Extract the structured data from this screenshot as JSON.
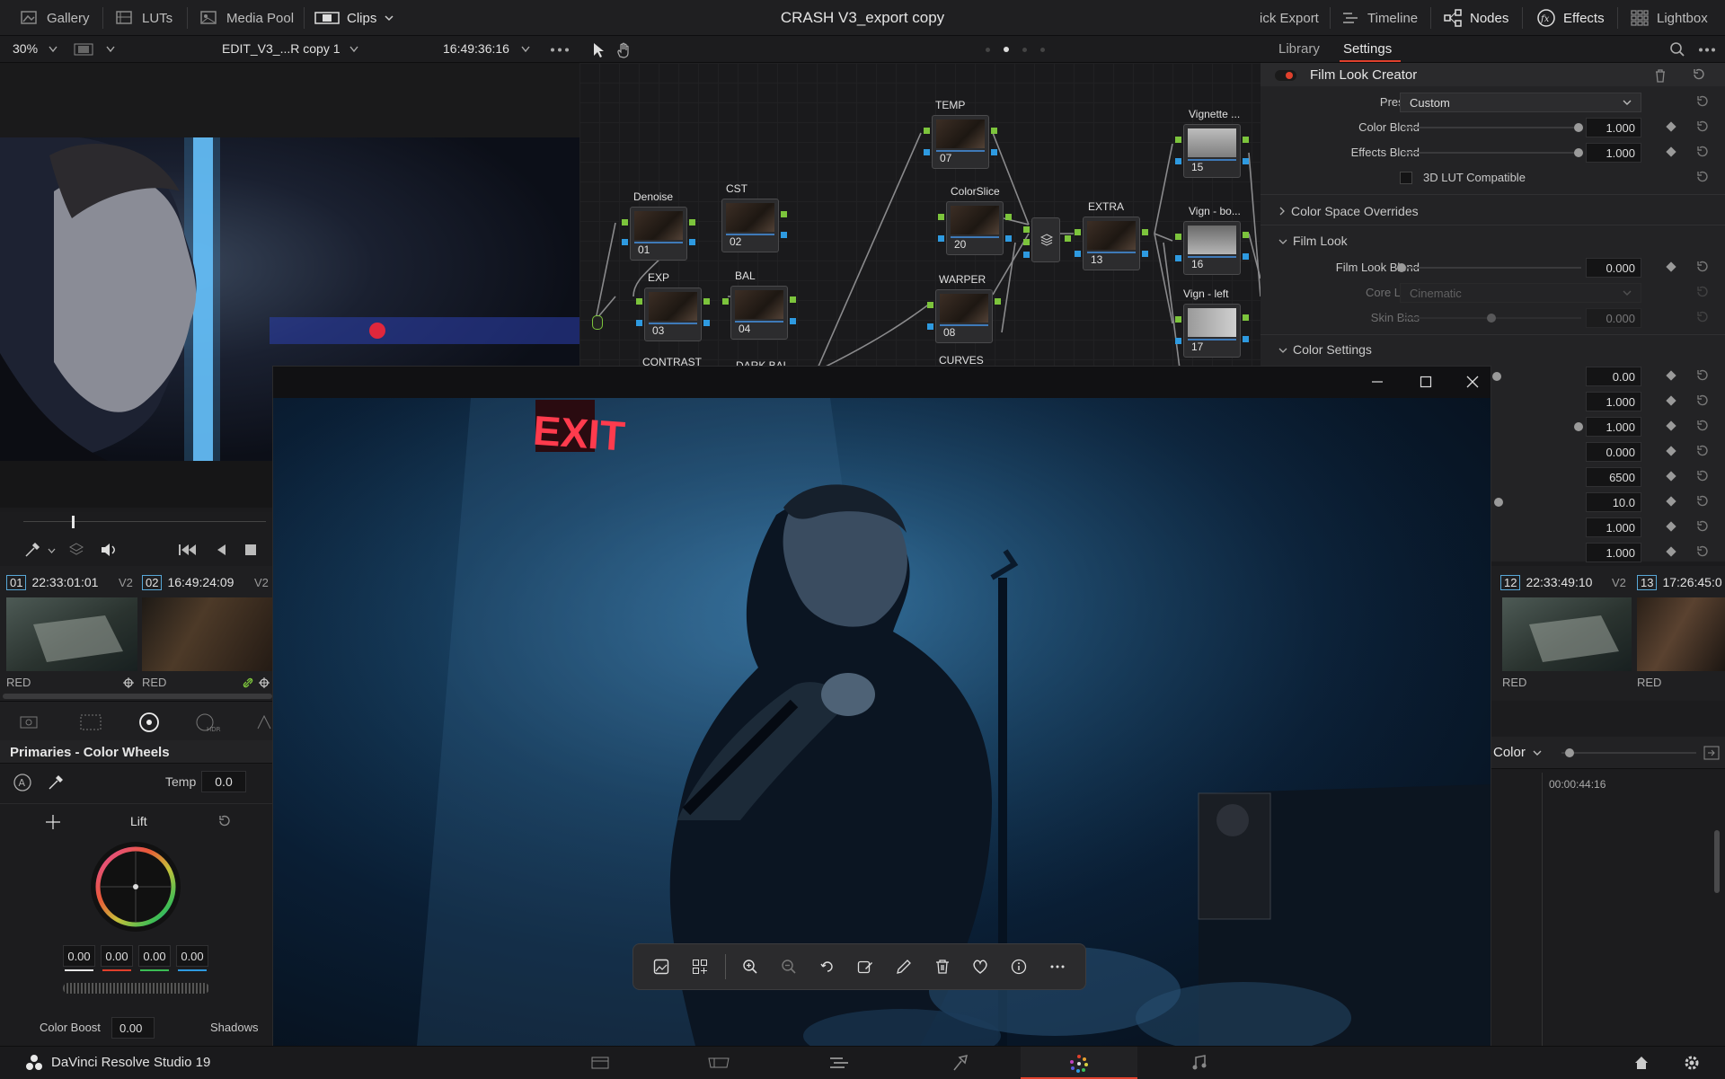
{
  "topbar": {
    "left_items": [
      {
        "label": "Gallery",
        "icon": "gallery-icon"
      },
      {
        "label": "LUTs",
        "icon": "luts-icon"
      },
      {
        "label": "Media Pool",
        "icon": "media-pool-icon"
      },
      {
        "label": "Clips",
        "icon": "clips-icon"
      }
    ],
    "title": "CRASH V3_export copy",
    "right_items": [
      {
        "label": "ick Export"
      },
      {
        "label": "Timeline",
        "icon": "timeline-icon"
      },
      {
        "label": "Nodes",
        "icon": "nodes-icon"
      },
      {
        "label": "Effects",
        "icon": "fx-icon"
      },
      {
        "label": "Lightbox",
        "icon": "lightbox-icon"
      }
    ]
  },
  "viewer": {
    "zoom": "30%",
    "clip_name": "EDIT_V3_...R copy 1",
    "timecode": "16:49:36:16"
  },
  "nodes": [
    {
      "label": "Denoise",
      "num": "01"
    },
    {
      "label": "CST",
      "num": "02"
    },
    {
      "label": "EXP",
      "num": "03"
    },
    {
      "label": "BAL",
      "num": "04"
    },
    {
      "label": "TEMP",
      "num": "07"
    },
    {
      "label": "ColorSlice",
      "num": "20"
    },
    {
      "label": "WARPER",
      "num": "08"
    },
    {
      "label": "EXTRA",
      "num": "13"
    },
    {
      "label": "Vignette ...",
      "num": "15"
    },
    {
      "label": "Vign - bo...",
      "num": "16"
    },
    {
      "label": "Vign - left",
      "num": "17"
    },
    {
      "label": "CONTRAST"
    },
    {
      "label": "DARK BAL"
    },
    {
      "label": "CURVES"
    }
  ],
  "inspector": {
    "tabs": [
      "Library",
      "Settings"
    ],
    "fx_name": "Film Look Creator",
    "presets_label": "Presets",
    "presets_value": "Custom",
    "color_blend_label": "Color Blend",
    "color_blend_value": "1.000",
    "effects_blend_label": "Effects Blend",
    "effects_blend_value": "1.000",
    "lut_label": "3D LUT Compatible",
    "sections": {
      "color_space": "Color Space Overrides",
      "film_look": "Film Look",
      "color_settings": "Color Settings"
    },
    "film_look_blend_label": "Film Look Blend",
    "film_look_blend_value": "0.000",
    "core_look_label": "Core Look",
    "core_look_value": "Cinematic",
    "skin_bias_label": "Skin Bias",
    "skin_bias_value": "0.000",
    "color_values": [
      "0.00",
      "1.000",
      "1.000",
      "0.000",
      "6500",
      "10.0",
      "1.000",
      "1.000"
    ]
  },
  "clips": {
    "left": [
      {
        "tag": "01",
        "tc": "22:33:01:01",
        "track": "V2",
        "codec": "RED"
      },
      {
        "tag": "02",
        "tc": "16:49:24:09",
        "track": "V2",
        "codec": "RED"
      }
    ],
    "right": [
      {
        "tag": "12",
        "tc": "22:33:49:10",
        "track": "V2",
        "codec": "RED"
      },
      {
        "tag": "13",
        "tc": "17:26:45:0",
        "track": "",
        "codec": "RED"
      }
    ]
  },
  "wheels": {
    "panel_title": "Primaries - Color Wheels",
    "temp_label": "Temp",
    "temp_value": "0.0",
    "wheel_label": "Lift",
    "wheel_values": [
      "0.00",
      "0.00",
      "0.00",
      "0.00"
    ],
    "color_boost_label": "Color Boost",
    "color_boost_value": "0.00",
    "shadows_label": "Shadows"
  },
  "right_bottom": {
    "dropdown": "Color",
    "timecode": "00:00:44:16"
  },
  "photo": {
    "sign_text": "EXIT"
  },
  "footer": {
    "app_name": "DaVinci Resolve Studio 19"
  },
  "colors": {
    "accent": "#e0402c",
    "node_green": "#7cc43c",
    "node_blue": "#2e9ae0"
  }
}
